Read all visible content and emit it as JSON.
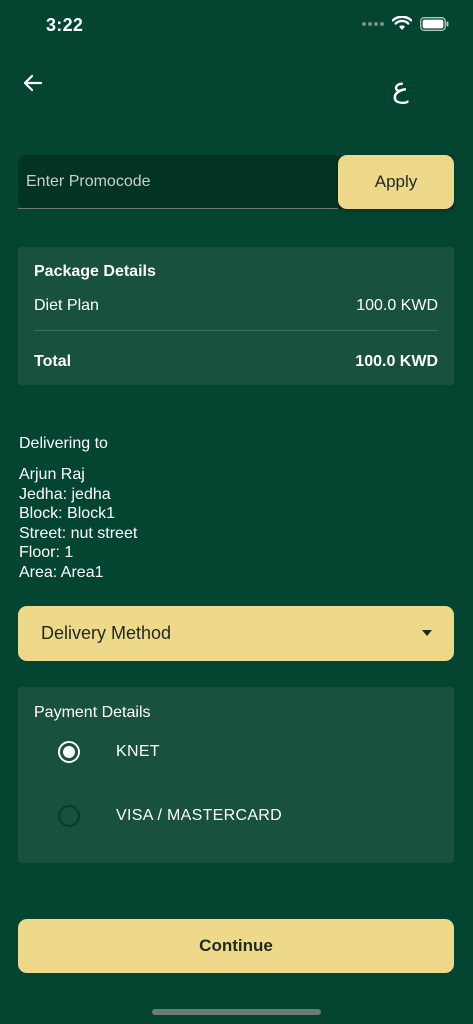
{
  "status_bar": {
    "time": "3:22"
  },
  "header": {
    "back_icon": "arrow-left-icon",
    "language_toggle": "ع"
  },
  "promo": {
    "placeholder": "Enter Promocode",
    "value": "",
    "apply_label": "Apply"
  },
  "package": {
    "title": "Package Details",
    "item_label": "Diet Plan",
    "item_price": "100.0 KWD",
    "total_label": "Total",
    "total_price": "100.0 KWD"
  },
  "delivery": {
    "heading": "Delivering to",
    "address_lines": [
      "Arjun Raj",
      "Jedha: jedha",
      "Block: Block1",
      "Street: nut street",
      "Floor: 1",
      "Area: Area1"
    ]
  },
  "delivery_method": {
    "label": "Delivery Method",
    "icon": "chevron-down-icon"
  },
  "payment": {
    "title": "Payment Details",
    "options": [
      {
        "label": "KNET",
        "selected": true
      },
      {
        "label": "VISA / MASTERCARD",
        "selected": false
      }
    ]
  },
  "footer": {
    "continue_label": "Continue"
  },
  "colors": {
    "background": "#034531",
    "card": "#18513c",
    "accent": "#eed98b",
    "input_bg": "#023324"
  }
}
